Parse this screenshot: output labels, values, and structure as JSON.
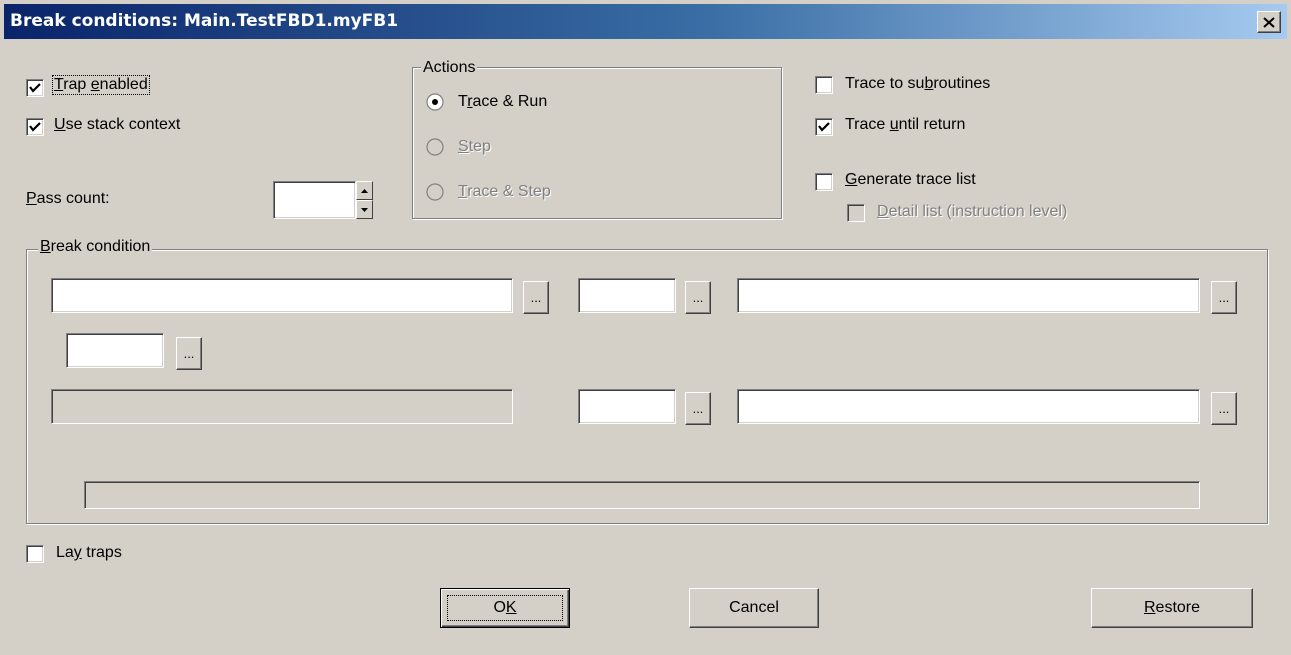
{
  "window": {
    "title": "Break conditions: Main.TestFBD1.myFB1"
  },
  "options": {
    "trap_enabled": {
      "label_pre": "",
      "label_ul": "T",
      "label_mid": "rap ",
      "label_ul2": "e",
      "label_post": "nabled",
      "checked": true
    },
    "use_stack_context": {
      "label_ul": "U",
      "label_post": "se stack context",
      "checked": true
    },
    "pass_count": {
      "label_ul": "P",
      "label_post": "ass count:",
      "value": ""
    }
  },
  "actions": {
    "title": "Actions",
    "trace_run": {
      "label_pre": "T",
      "label_ul": "r",
      "label_post": "ace & Run",
      "selected": true
    },
    "step": {
      "label_ul": "S",
      "label_post": "tep",
      "enabled": false
    },
    "trace_step": {
      "label_ul": "T",
      "label_post": "race & Step",
      "enabled": false
    }
  },
  "trace": {
    "trace_to_subroutines": {
      "label_pre": "Trace to su",
      "label_ul": "b",
      "label_post": "routines",
      "checked": false
    },
    "trace_until_return": {
      "label_pre": "Trace ",
      "label_ul": "u",
      "label_post": "ntil return",
      "checked": true
    },
    "generate_trace_list": {
      "label_ul": "G",
      "label_post": "enerate trace list",
      "checked": false
    },
    "detail_list": {
      "label_ul": "D",
      "label_post": "etail list (instruction level)",
      "checked": false,
      "enabled": false
    }
  },
  "break_condition": {
    "title_ul": "B",
    "title_post": "reak condition",
    "browse_label": "..."
  },
  "lay_traps": {
    "label_pre": "La",
    "label_ul": "y",
    "label_post": " traps",
    "checked": false
  },
  "buttons": {
    "ok_pre": "O",
    "ok_ul": "K",
    "cancel": "Cancel",
    "restore_ul": "R",
    "restore_post": "estore"
  }
}
